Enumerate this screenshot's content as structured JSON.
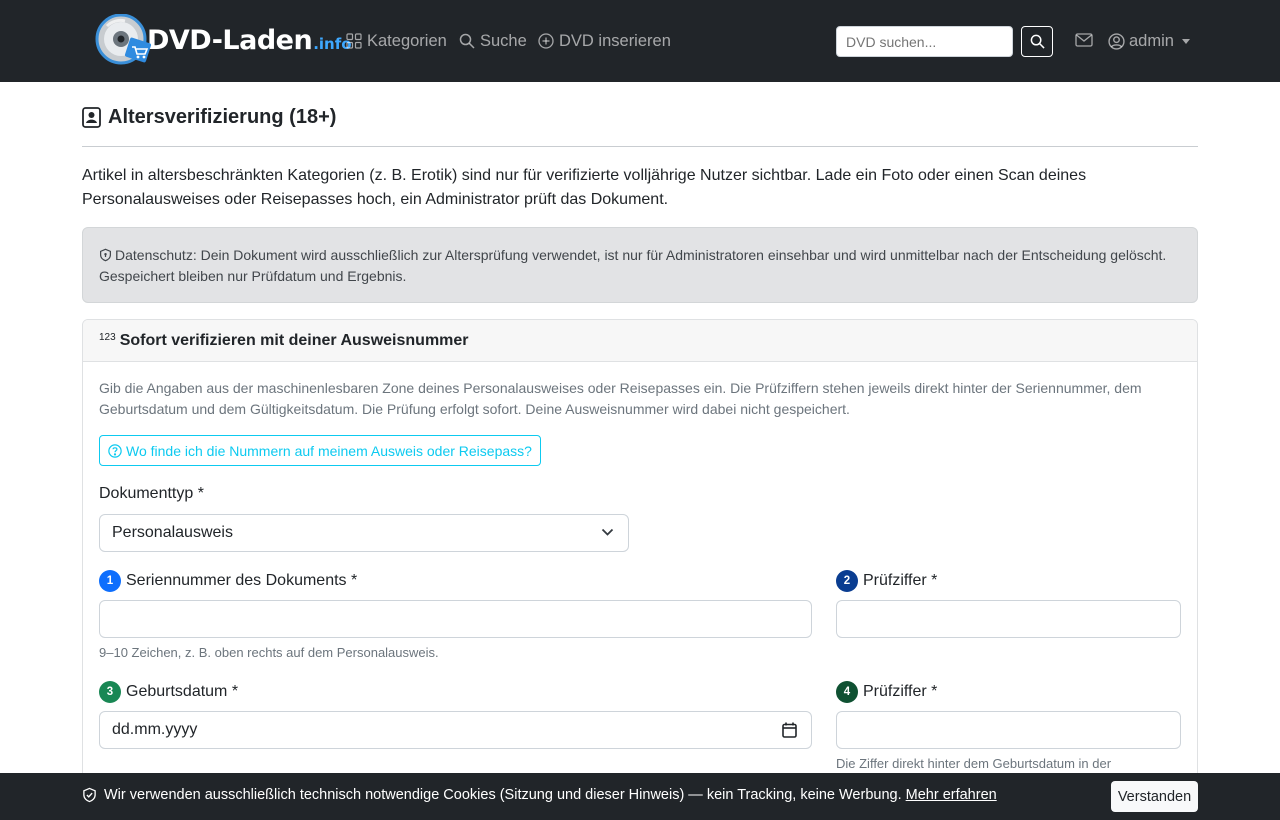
{
  "nav": {
    "brand_name": "DVD-Laden",
    "brand_tld": ".info",
    "links": [
      {
        "label": "Kategorien",
        "icon": "grid-icon"
      },
      {
        "label": "Suche",
        "icon": "search-icon"
      },
      {
        "label": "DVD inserieren",
        "icon": "plus-circle-icon"
      }
    ],
    "search_placeholder": "DVD suchen...",
    "user_label": "admin"
  },
  "page": {
    "title": "Altersverifizierung (18+)",
    "lead": "Artikel in altersbeschränkten Kategorien (z. B. Erotik) sind nur für verifizierte volljährige Nutzer sichtbar. Lade ein Foto oder einen Scan deines Personalausweises oder Reisepasses hoch, ein Administrator prüft das Dokument.",
    "privacy_notice": "Datenschutz: Dein Dokument wird ausschließlich zur Altersprüfung verwendet, ist nur für Administratoren einsehbar und wird unmittelbar nach der Entscheidung gelöscht. Gespeichert bleiben nur Prüfdatum und Ergebnis."
  },
  "card": {
    "header_icon_text": "123",
    "header": "Sofort verifizieren mit deiner Ausweisnummer",
    "description": "Gib die Angaben aus der maschinenlesbaren Zone deines Personalausweises oder Reisepasses ein. Die Prüfziffern stehen jeweils direkt hinter der Seriennummer, dem Geburtsdatum und dem Gültigkeitsdatum. Die Prüfung erfolgt sofort. Deine Ausweisnummer wird dabei nicht gespeichert.",
    "help_button": "Wo finde ich die Nummern auf meinem Ausweis oder Reisepass?",
    "doc_type_label": "Dokumenttyp *",
    "doc_type_value": "Personalausweis",
    "fields": {
      "serial": {
        "step": "1",
        "label": "Seriennummer des Dokuments *",
        "help": "9–10 Zeichen, z. B. oben rechts auf dem Personalausweis.",
        "value": ""
      },
      "check1": {
        "step": "2",
        "label": "Prüfziffer *",
        "value": ""
      },
      "birthdate": {
        "step": "3",
        "label": "Geburtsdatum *",
        "placeholder": "dd.mm.yyyy"
      },
      "check2": {
        "step": "4",
        "label": "Prüfziffer *",
        "help": "Die Ziffer direkt hinter dem Geburtsdatum in der",
        "value": ""
      }
    }
  },
  "cookie": {
    "text": "Wir verwenden ausschließlich technisch notwendige Cookies (Sitzung und dieser Hinweis) — kein Tracking, keine Werbung.",
    "link": "Mehr erfahren",
    "button": "Verstanden"
  },
  "colors": {
    "navbar_bg": "#212529",
    "step_blue": "#0d6efd",
    "step_navy": "#0a3d91",
    "step_green": "#198754",
    "step_dark_green": "#0f5132",
    "info_outline": "#0dcaf0",
    "alert_bg": "#e2e3e5"
  }
}
